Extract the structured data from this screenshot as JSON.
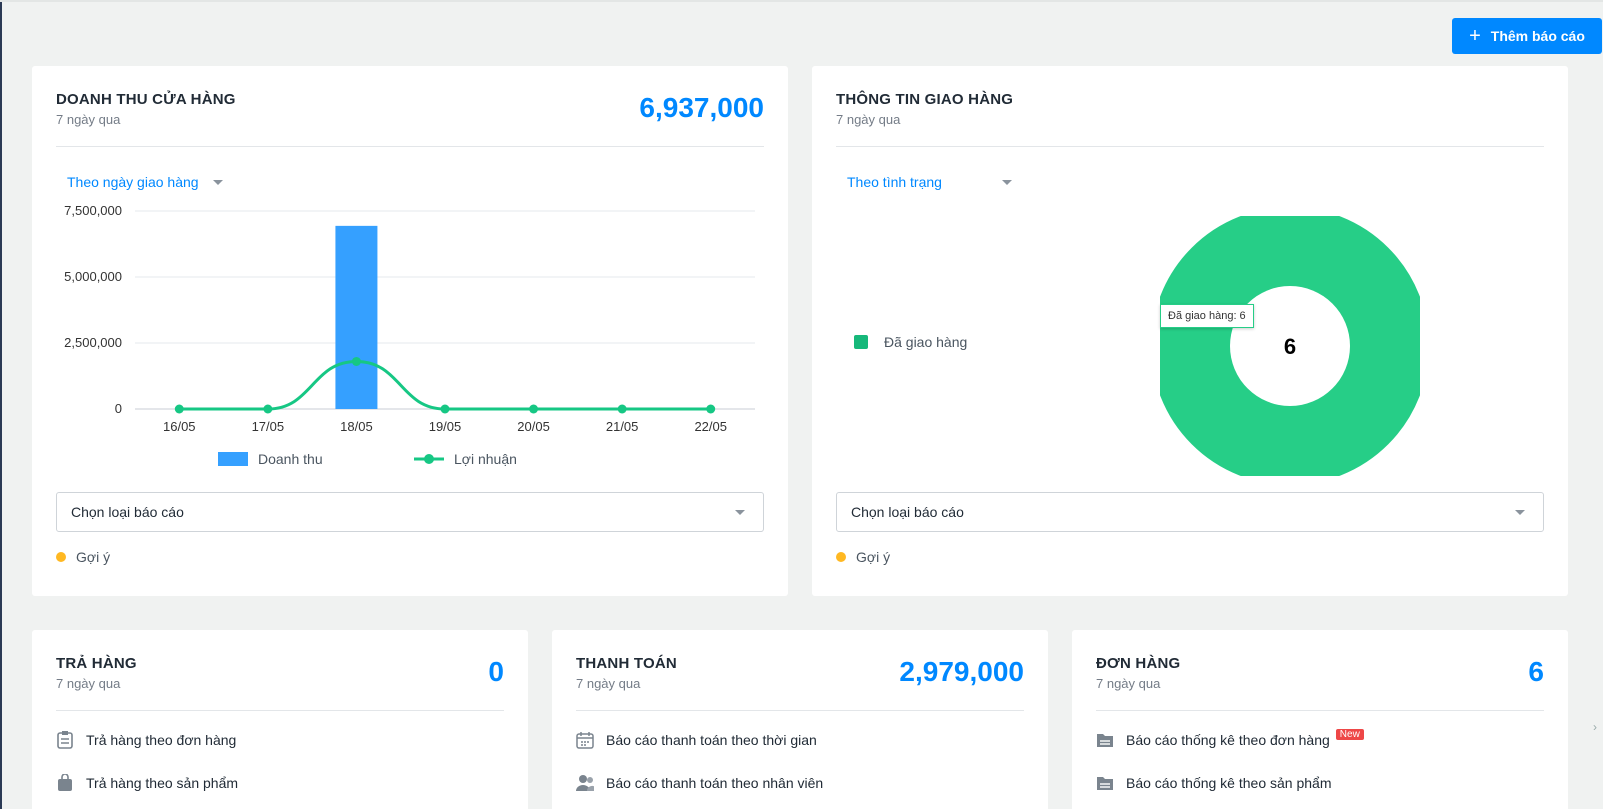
{
  "header": {
    "add_report_label": "Thêm báo cáo"
  },
  "revenue": {
    "title": "DOANH THU CỬA HÀNG",
    "subtitle": "7 ngày qua",
    "value": "6,937,000",
    "filter_label": "Theo ngày giao hàng",
    "select_label": "Chọn loại báo cáo",
    "hint_label": "Gợi ý",
    "legend_bar": "Doanh thu",
    "legend_line": "Lợi nhuận"
  },
  "delivery": {
    "title": "THÔNG TIN GIAO HÀNG",
    "subtitle": "7 ngày qua",
    "filter_label": "Theo tình trạng",
    "select_label": "Chọn loại báo cáo",
    "hint_label": "Gợi ý",
    "legend_item": "Đã giao hàng",
    "center_value": "6",
    "tooltip": "Đã giao hàng: 6"
  },
  "returns": {
    "title": "TRẢ HÀNG",
    "subtitle": "7 ngày qua",
    "value": "0",
    "items": [
      "Trả hàng theo đơn hàng",
      "Trả hàng theo sản phẩm"
    ]
  },
  "payments": {
    "title": "THANH TOÁN",
    "subtitle": "7 ngày qua",
    "value": "2,979,000",
    "items": [
      "Báo cáo thanh toán theo thời gian",
      "Báo cáo thanh toán theo nhân viên"
    ]
  },
  "orders": {
    "title": "ĐƠN HÀNG",
    "subtitle": "7 ngày qua",
    "value": "6",
    "new_badge": "New",
    "items": [
      "Báo cáo thống kê theo đơn hàng",
      "Báo cáo thống kê theo sản phẩm"
    ]
  },
  "colors": {
    "accent": "#0088ff",
    "bar": "#35a0ff",
    "line": "#16c784",
    "donut": "#26ce87",
    "hint": "#ffb822"
  },
  "chart_data": [
    {
      "type": "bar",
      "categories": [
        "16/05",
        "17/05",
        "18/05",
        "19/05",
        "20/05",
        "21/05",
        "22/05"
      ],
      "series": [
        {
          "name": "Doanh thu",
          "type": "bar",
          "values": [
            0,
            0,
            6937000,
            0,
            0,
            0,
            0
          ]
        },
        {
          "name": "Lợi nhuận",
          "type": "line",
          "values": [
            0,
            0,
            1800000,
            0,
            0,
            0,
            0
          ]
        }
      ],
      "yticks": [
        "7,500,000",
        "5,000,000",
        "2,500,000",
        "0"
      ],
      "ylim": [
        0,
        7500000
      ],
      "grid": true,
      "legend": "bottom"
    },
    {
      "type": "pie",
      "categories": [
        "Đã giao hàng"
      ],
      "values": [
        6
      ],
      "legend": "left"
    }
  ]
}
